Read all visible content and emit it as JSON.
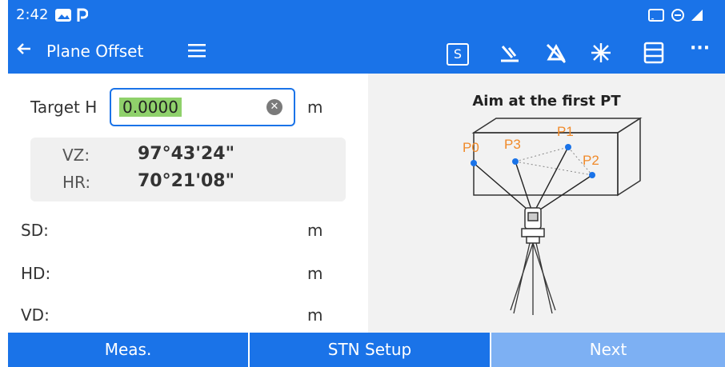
{
  "status_bar": {
    "time": "2:42",
    "left_icons": [
      "gallery-icon",
      "parking-icon"
    ],
    "right_icons": [
      "cast-icon",
      "do-not-disturb-icon",
      "signal-icon"
    ]
  },
  "app_bar": {
    "title": "Plane Offset",
    "back_icon": "arrow-left-icon",
    "menu_icon": "hamburger-menu-icon",
    "s_label": "S",
    "actions": [
      "bluetooth-icon",
      "prism-off-icon",
      "laser-icon",
      "list-icon",
      "more-icon"
    ],
    "more_label": "···"
  },
  "form": {
    "target_h_label": "Target H",
    "target_h_value": "0.0000",
    "target_h_unit": "m",
    "vz_label": "VZ:",
    "vz_value": "97°43'24\"",
    "hr_label": "HR:",
    "hr_value": "70°21'08\"",
    "sd_label": "SD:",
    "hd_label": "HD:",
    "vd_label": "VD:",
    "unit": "m"
  },
  "diagram": {
    "hint": "Aim at the first PT",
    "points": [
      "P0",
      "P1",
      "P2",
      "P3"
    ]
  },
  "buttons": {
    "meas": "Meas.",
    "stn_setup": "STN Setup",
    "next": "Next"
  },
  "colors": {
    "primary": "#1a73e8",
    "next_button": "#7db0f3",
    "highlight": "#8fd16b",
    "point_label": "#f08a2a",
    "point_dot": "#1a73e8"
  }
}
